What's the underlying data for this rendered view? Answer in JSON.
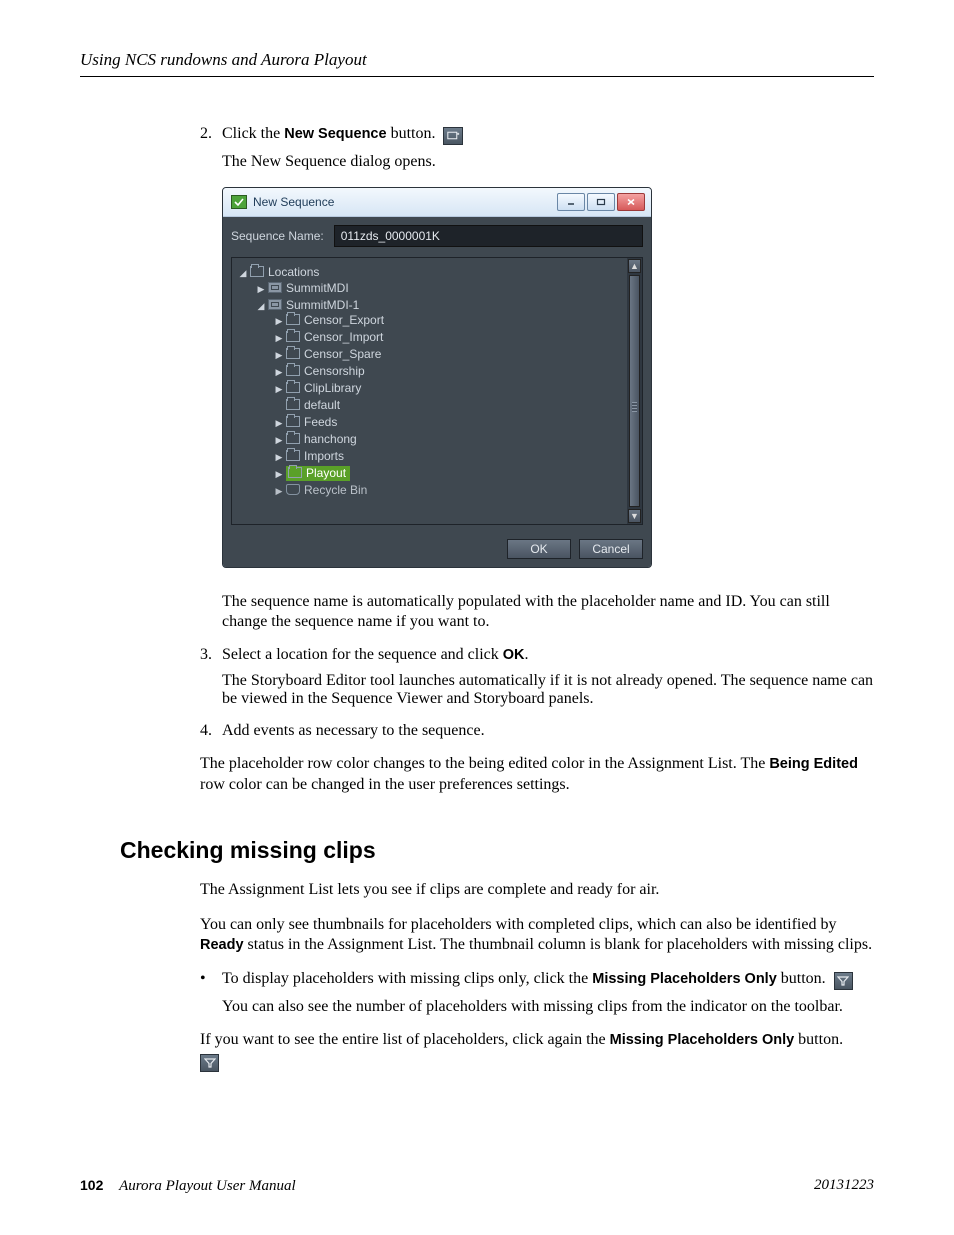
{
  "running_head": "Using NCS rundowns and Aurora Playout",
  "steps": {
    "s2": {
      "num": "2.",
      "text_before": "Click the ",
      "bold": "New Sequence",
      "text_after": " button.",
      "follow": "The New Sequence dialog opens."
    },
    "s2para": "The sequence name is automatically populated with the placeholder name and ID. You can still change the sequence name if you want to.",
    "s3": {
      "num": "3.",
      "text_before": "Select a location for the sequence and click ",
      "bold": "OK",
      "text_after": ".",
      "follow": "The Storyboard Editor tool launches automatically if it is not already opened. The sequence name can be viewed in the Sequence Viewer and Storyboard panels."
    },
    "s4": {
      "num": "4.",
      "text": "Add events as necessary to the sequence."
    }
  },
  "after_steps": {
    "pre": "The placeholder row color changes to the being edited color in the Assignment List. The ",
    "bold": "Being Edited",
    "post": " row color can be changed in the user preferences settings."
  },
  "dialog": {
    "title": "New Sequence",
    "seq_label": "Sequence Name:",
    "seq_value": "011zds_0000001K",
    "tree_root": "Locations",
    "tree_l1a": "SummitMDI",
    "tree_l1b": "SummitMDI-1",
    "tree_items": [
      "Censor_Export",
      "Censor_Import",
      "Censor_Spare",
      "Censorship",
      "ClipLibrary",
      "default",
      "Feeds",
      "hanchong",
      "Imports",
      "Playout",
      "Recycle Bin"
    ],
    "ok": "OK",
    "cancel": "Cancel"
  },
  "section2": {
    "heading": "Checking missing clips",
    "p1": "The Assignment List lets you see if clips are complete and ready for air.",
    "p2_pre": "You can only see thumbnails for placeholders with completed clips, which can also be identified by ",
    "p2_bold": "Ready",
    "p2_post": " status in the Assignment List. The thumbnail column is blank for placeholders with missing clips.",
    "bullet_pre": "To display placeholders with missing clips only, click the ",
    "bullet_bold": "Missing Placeholders Only",
    "bullet_post": " button.",
    "bullet_follow": "You can also see the number of placeholders with missing clips from the indicator on the toolbar.",
    "p3_pre": "If you want to see the entire list of placeholders, click again the ",
    "p3_bold": "Missing Placeholders Only",
    "p3_post": " button."
  },
  "footer": {
    "page": "102",
    "book": "Aurora Playout   User Manual",
    "date": "20131223"
  }
}
